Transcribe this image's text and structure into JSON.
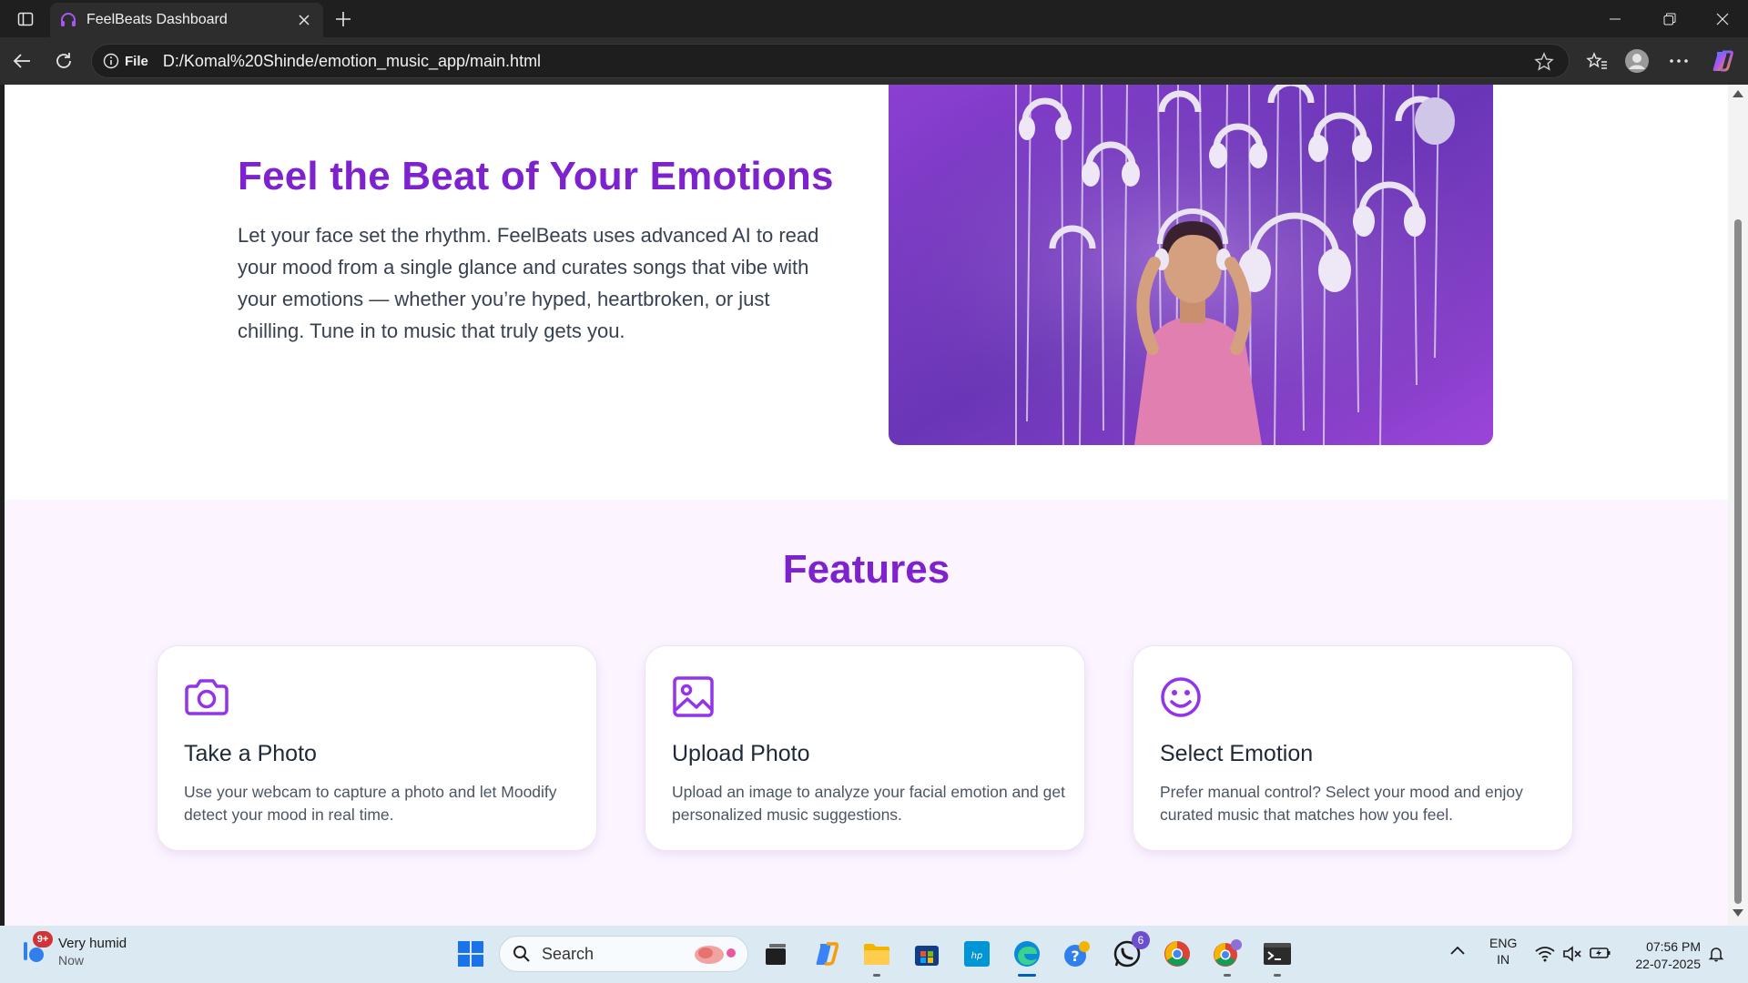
{
  "browser": {
    "tab_title": "FeelBeats Dashboard",
    "address_chip": "File",
    "url": "D:/Komal%20Shinde/emotion_music_app/main.html"
  },
  "hero": {
    "title": "Feel the Beat of Your Emotions",
    "description": "Let your face set the rhythm. FeelBeats uses advanced AI to read your mood from a single glance and curates songs that vibe with your emotions — whether you’re hyped, heartbroken, or just chilling. Tune in to music that truly gets you."
  },
  "features": {
    "title": "Features",
    "cards": [
      {
        "icon": "camera-icon",
        "title": "Take a Photo",
        "description": "Use your webcam to capture a photo and let Moodify detect your mood in real time."
      },
      {
        "icon": "image-icon",
        "title": "Upload Photo",
        "description": "Upload an image to analyze your facial emotion and get personalized music suggestions."
      },
      {
        "icon": "smiley-icon",
        "title": "Select Emotion",
        "description": "Prefer manual control? Select your mood and enjoy curated music that matches how you feel."
      }
    ]
  },
  "colors": {
    "accent": "#7e22ce",
    "features_bg": "#fcf5ff",
    "text": "#374151"
  },
  "taskbar": {
    "weather_title": "Very humid",
    "weather_sub": "Now",
    "weather_badge": "9+",
    "search_label": "Search",
    "whatsapp_badge": "6",
    "lang_top": "ENG",
    "lang_bottom": "IN",
    "time": "07:56 PM",
    "date": "22-07-2025"
  }
}
